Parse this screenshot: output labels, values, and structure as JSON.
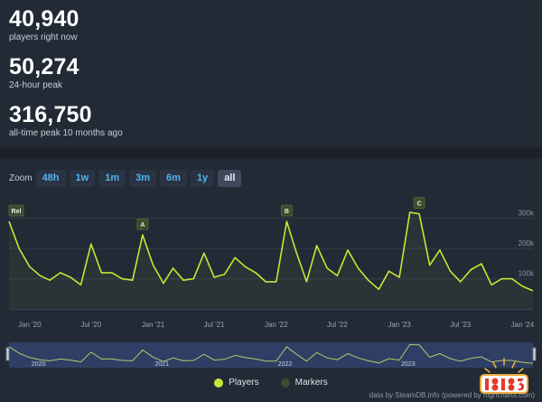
{
  "stats": [
    {
      "value": "40,940",
      "label": "players right now"
    },
    {
      "value": "50,274",
      "label": "24-hour peak"
    },
    {
      "value": "316,750",
      "label": "all-time peak 10 months ago"
    }
  ],
  "zoom": {
    "label": "Zoom",
    "buttons": [
      "48h",
      "1w",
      "1m",
      "3m",
      "6m",
      "1y",
      "all"
    ],
    "active": "all"
  },
  "legend": {
    "players": "Players",
    "markers": "Markers"
  },
  "credit": "data by SteamDB.info (powered by highcharts.com)",
  "watermark": "18183",
  "colors": {
    "line": "#c8e635",
    "marker_bg": "#3b4c2b",
    "accent": "#51b4f0",
    "navigator_band": "#3a4f8a"
  },
  "chart_data": {
    "type": "line",
    "series": [
      {
        "name": "Players",
        "x": [
          "2019-11-01",
          "2019-12-01",
          "2020-01-01",
          "2020-02-01",
          "2020-03-01",
          "2020-04-01",
          "2020-05-01",
          "2020-06-01",
          "2020-07-01",
          "2020-08-01",
          "2020-09-01",
          "2020-10-01",
          "2020-11-01",
          "2020-12-01",
          "2021-01-01",
          "2021-02-01",
          "2021-03-01",
          "2021-04-01",
          "2021-05-01",
          "2021-06-01",
          "2021-07-01",
          "2021-08-01",
          "2021-09-01",
          "2021-10-01",
          "2021-11-01",
          "2021-12-01",
          "2022-01-01",
          "2022-02-01",
          "2022-03-01",
          "2022-04-01",
          "2022-05-01",
          "2022-06-01",
          "2022-07-01",
          "2022-08-01",
          "2022-09-01",
          "2022-10-01",
          "2022-11-01",
          "2022-12-01",
          "2023-01-01",
          "2023-02-01",
          "2023-03-01",
          "2023-04-01",
          "2023-05-01",
          "2023-06-01",
          "2023-07-01",
          "2023-08-01",
          "2023-09-01",
          "2023-10-01",
          "2023-11-01",
          "2023-12-01",
          "2024-01-01",
          "2024-02-01"
        ],
        "values": [
          290000,
          200000,
          140000,
          110000,
          95000,
          120000,
          105000,
          80000,
          215000,
          120000,
          120000,
          100000,
          95000,
          245000,
          145000,
          85000,
          135000,
          95000,
          100000,
          185000,
          105000,
          115000,
          170000,
          140000,
          120000,
          90000,
          90000,
          290000,
          190000,
          90000,
          210000,
          135000,
          110000,
          195000,
          135000,
          95000,
          65000,
          125000,
          105000,
          320000,
          315000,
          145000,
          195000,
          125000,
          90000,
          130000,
          150000,
          80000,
          100000,
          100000,
          75000,
          60000
        ]
      }
    ],
    "markers": [
      {
        "label": "Rel",
        "x": "2019-11-01"
      },
      {
        "label": "A",
        "x": "2020-12-01"
      },
      {
        "label": "B",
        "x": "2022-02-01"
      },
      {
        "label": "C",
        "x": "2023-03-01"
      }
    ],
    "y_ticks": [
      "100k",
      "200k",
      "300k"
    ],
    "ylim": [
      0,
      350000
    ],
    "x_ticks": [
      "Jan '20",
      "Jul '20",
      "Jan '21",
      "Jul '21",
      "Jan '22",
      "Jul '22",
      "Jan '23",
      "Jul '23",
      "Jan '24"
    ],
    "navigator_ticks": [
      "2020",
      "2021",
      "2022",
      "2023"
    ],
    "grid": true,
    "legend_position": "bottom"
  }
}
